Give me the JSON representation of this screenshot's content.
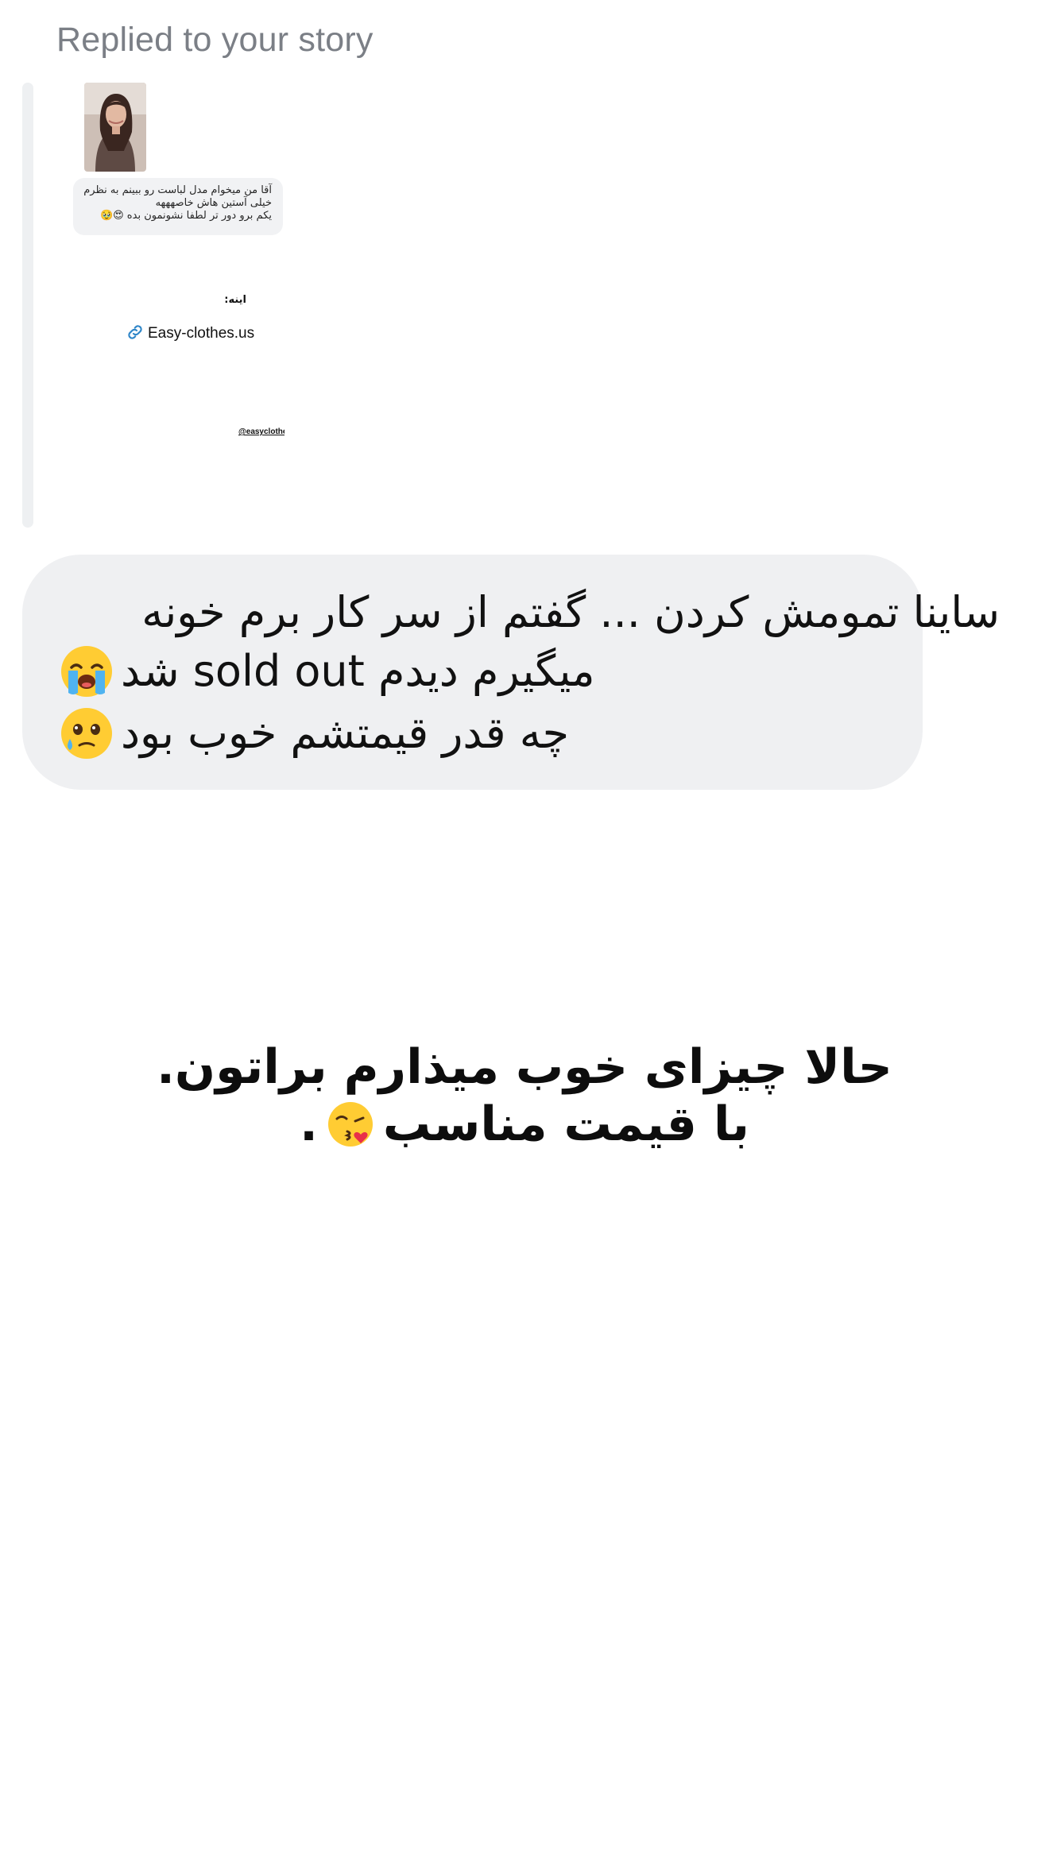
{
  "reply_header": {
    "text": "Replied to your story"
  },
  "story_preview": {
    "reply_lines": [
      "آقا من میخوام مدل لباست رو ببینم به نظرم",
      "خیلی آستین هاش خاصهههه",
      "یکم برو دور تر لطفا نشونمون بده 😍🥹"
    ],
    "label": "اینه:",
    "link_text": "Easy-clothes.us",
    "handle": "@easyclothesusa"
  },
  "message": {
    "line1": "ساینا تمومش کردن ... گفتم از سر کار برم خونه",
    "line2": "میگیرم دیدم sold out شد",
    "line3": "چه قدر قیمتشم خوب بود",
    "line2_emoji": "loudly-crying-face-icon",
    "line3_emoji": "face-holding-back-tears-icon"
  },
  "story_caption": {
    "line1": "حالا چیزای خوب میذارم براتون.",
    "line2": "با قیمت مناسب",
    "line2_emoji": "face-blowing-kiss-icon",
    "line2_end": "."
  },
  "colors": {
    "header_text": "#7b7f86",
    "bubble_bg": "#eff0f2",
    "text": "#111111",
    "link_icon": "#2f86c8"
  }
}
